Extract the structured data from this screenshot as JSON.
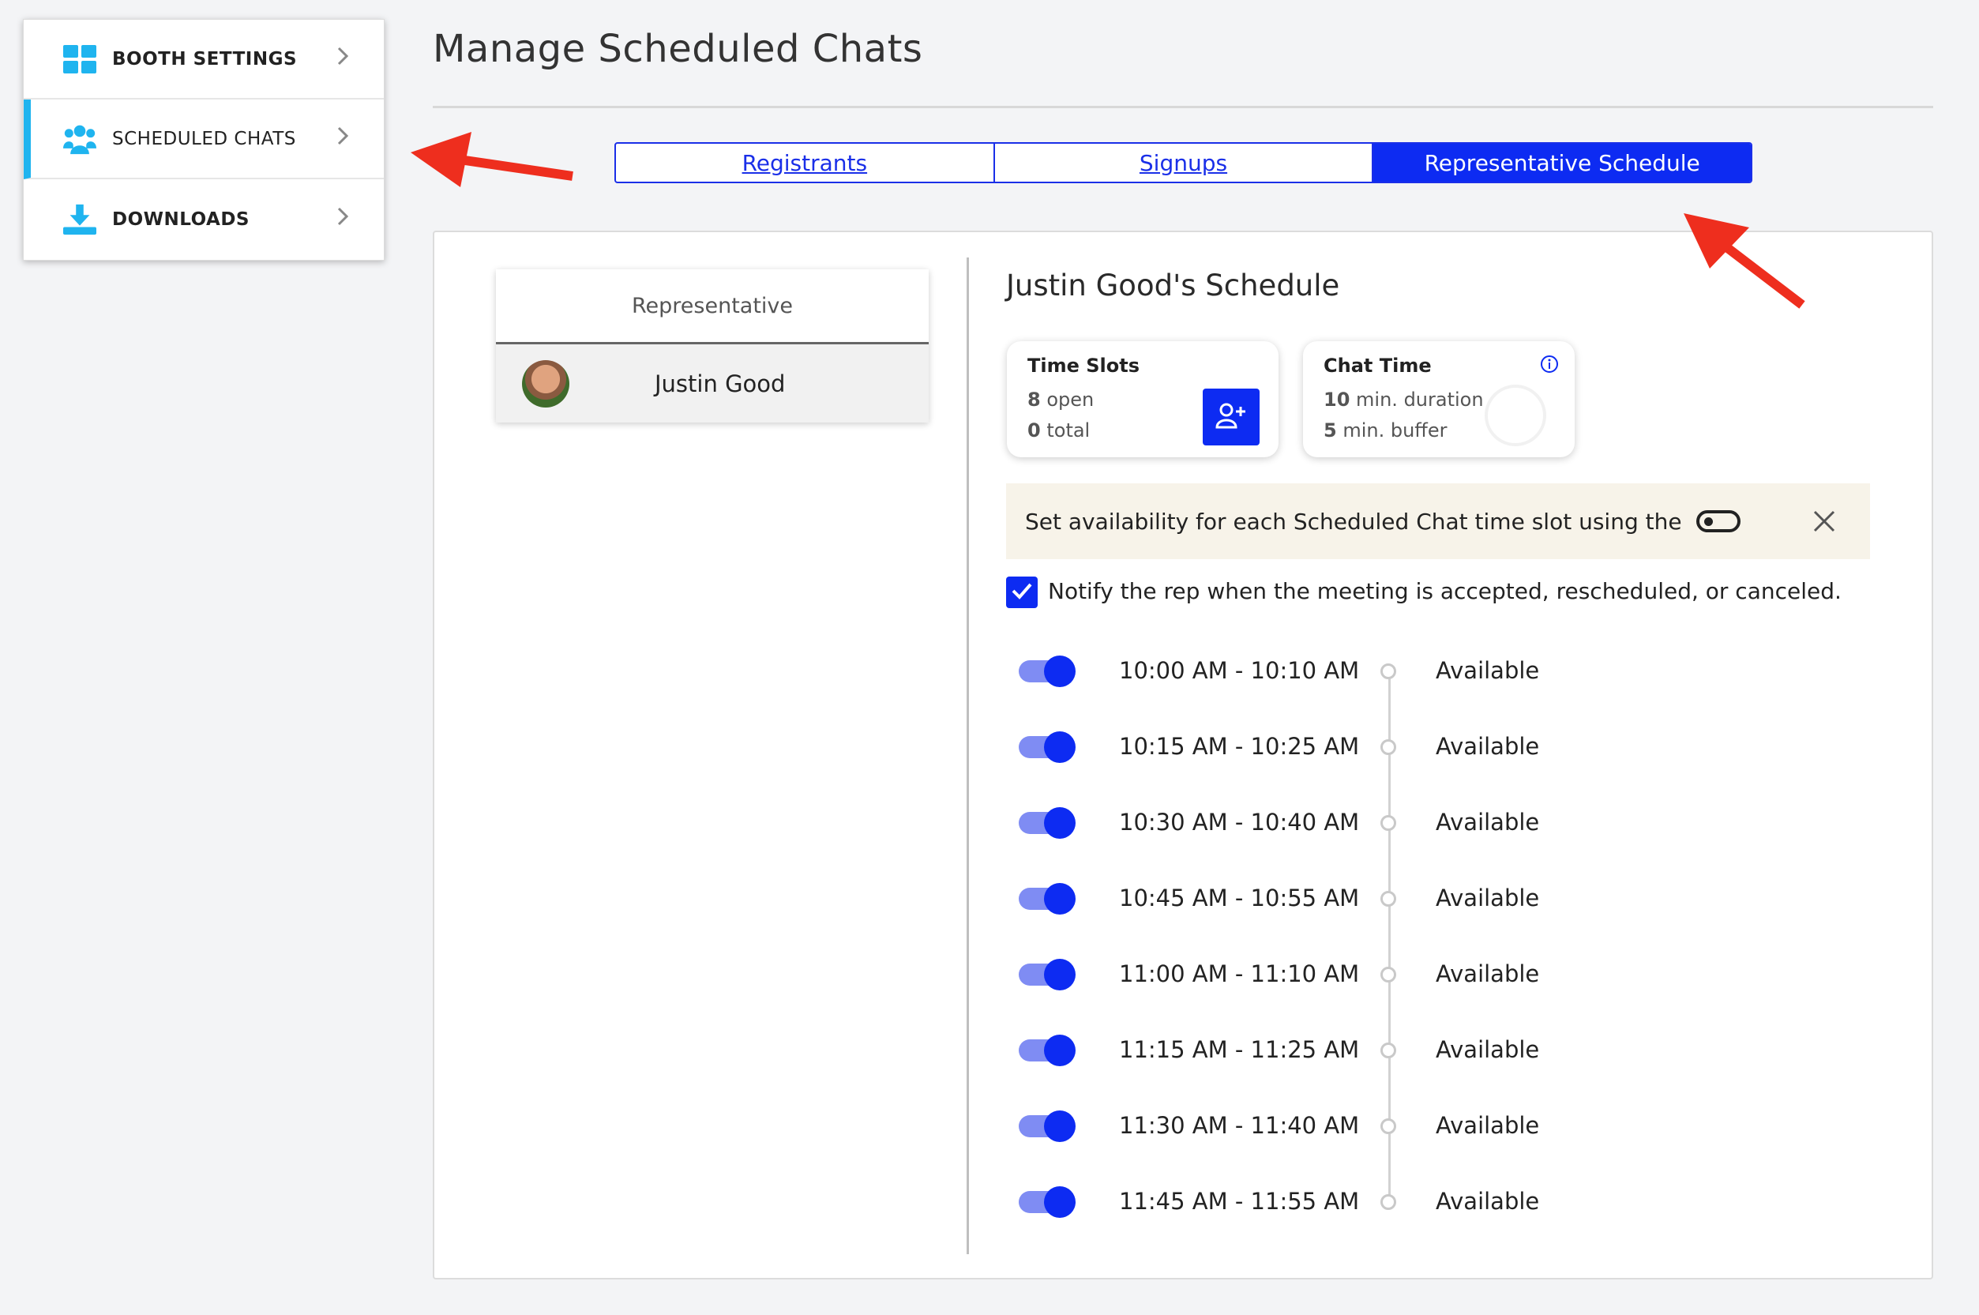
{
  "sidebar": {
    "items": [
      {
        "label": "BOOTH SETTINGS",
        "icon": "grid-icon"
      },
      {
        "label": "SCHEDULED CHATS",
        "icon": "users-icon"
      },
      {
        "label": "DOWNLOADS",
        "icon": "download-icon"
      }
    ]
  },
  "page": {
    "title": "Manage Scheduled Chats"
  },
  "tabs": [
    {
      "label": "Registrants"
    },
    {
      "label": "Signups"
    },
    {
      "label": "Representative Schedule"
    }
  ],
  "representatives": {
    "header": "Representative",
    "rows": [
      {
        "name": "Justin Good"
      }
    ]
  },
  "schedule": {
    "title": "Justin Good's Schedule",
    "time_slots_card": {
      "title": "Time Slots",
      "open_count": "8",
      "open_label": "open",
      "total_count": "0",
      "total_label": "total"
    },
    "chat_time_card": {
      "title": "Chat Time",
      "duration_value": "10",
      "duration_label": "min. duration",
      "buffer_value": "5",
      "buffer_label": "min. buffer"
    },
    "banner_text": "Set availability for each Scheduled Chat time slot using the",
    "notify_label": "Notify the rep when the meeting is accepted, rescheduled, or canceled.",
    "notify_checked": true,
    "slots": [
      {
        "time": "10:00 AM - 10:10 AM",
        "status": "Available",
        "enabled": true
      },
      {
        "time": "10:15 AM - 10:25 AM",
        "status": "Available",
        "enabled": true
      },
      {
        "time": "10:30 AM - 10:40 AM",
        "status": "Available",
        "enabled": true
      },
      {
        "time": "10:45 AM - 10:55 AM",
        "status": "Available",
        "enabled": true
      },
      {
        "time": "11:00 AM - 11:10 AM",
        "status": "Available",
        "enabled": true
      },
      {
        "time": "11:15 AM - 11:25 AM",
        "status": "Available",
        "enabled": true
      },
      {
        "time": "11:30 AM - 11:40 AM",
        "status": "Available",
        "enabled": true
      },
      {
        "time": "11:45 AM - 11:55 AM",
        "status": "Available",
        "enabled": true
      }
    ]
  },
  "colors": {
    "accent": "#0d2bf2",
    "sidebar_accent": "#1fb4ef",
    "annotation_arrow": "#ee2e1e"
  }
}
